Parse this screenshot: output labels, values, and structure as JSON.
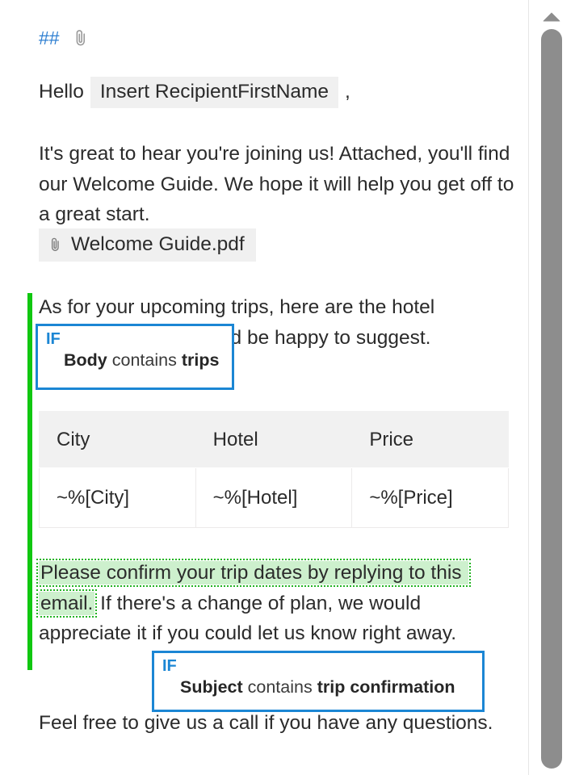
{
  "editor": {
    "top_markers": {
      "heading_marker": "##",
      "attachment_icon_name": "paperclip-icon"
    },
    "greeting": {
      "prefix": "Hello",
      "merge_field": "Insert RecipientFirstName",
      "suffix": ","
    },
    "paragraph_welcome": "It's great to hear you're joining us! Attached, you'll find our Welcome Guide. We hope it will help you get off to a great start.",
    "attachment": {
      "icon": "paperclip-icon",
      "filename": "Welcome Guide.pdf"
    },
    "paragraph_trips": "As for your upcoming trips, here are the hotel recommendations we'd be happy to suggest.",
    "paragraph_confirm": {
      "highlighted": "Please confirm your trip dates by replying to this email.",
      "rest": " If there's a change of plan, we would appreciate it if you could let us know right away."
    },
    "paragraph_callus": "Feel free to give us a call if you have any questions.",
    "change_bar_color": "#10c710",
    "highlight_color": "#cdf0cd",
    "highlight_border_color": "#22b422"
  },
  "conditions": [
    {
      "id": "if-body-trips",
      "keyword": "IF",
      "field": "Body",
      "operator": "contains",
      "value": "trips",
      "accent_color": "#1b86d4"
    },
    {
      "id": "if-subject-trip-confirmation",
      "keyword": "IF",
      "field": "Subject",
      "operator": "contains",
      "value": "trip confirmation",
      "accent_color": "#1b86d4"
    }
  ],
  "table": {
    "headers": [
      "City",
      "Hotel",
      "Price"
    ],
    "rows": [
      [
        "~%[City]",
        "~%[Hotel]",
        "~%[Price]"
      ]
    ]
  },
  "scrollbar": {
    "up_arrow_icon": "chevron-up-icon",
    "thumb_color": "#8d8d8d"
  }
}
